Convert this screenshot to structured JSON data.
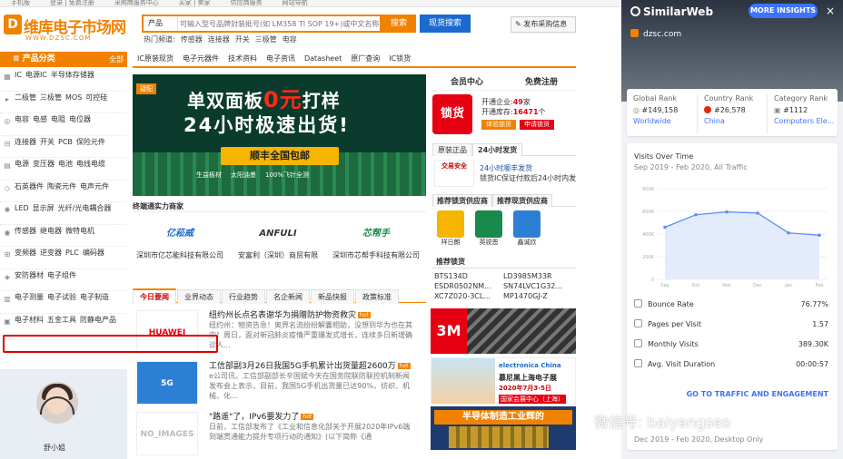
{
  "topstrip": [
    "手机版",
    "登录 | 免费注册",
    "采购商服务中心",
    "买家 | 卖家",
    "供应商服务",
    "网站导航"
  ],
  "logo": {
    "mark": "D",
    "name": "维库电子市场网",
    "url": "WWW.DZSC.COM"
  },
  "search": {
    "category": "产品",
    "placeholder": "可输入型号品牌封装批号(如 LM358 TI SOP 19+)或中文名称",
    "search_label": "搜索",
    "stock_label": "现货搜索",
    "post_label": "发布采购信息"
  },
  "hot": [
    "热门频道:",
    "传感器",
    "连接器",
    "开关",
    "三极管",
    "电容"
  ],
  "categories": {
    "title": "产品分类",
    "all": "全部",
    "items": [
      [
        "IC",
        "电源IC",
        "半导体存储器"
      ],
      [
        "二极管",
        "三极管",
        "MOS",
        "可控硅"
      ],
      [
        "电容",
        "电感",
        "电阻",
        "电位器"
      ],
      [
        "连接器",
        "开关",
        "PCB",
        "保险元件"
      ],
      [
        "电源",
        "变压器",
        "电池",
        "电线电缆"
      ],
      [
        "石英器件",
        "陶瓷元件",
        "电声元件"
      ],
      [
        "LED",
        "显示屏",
        "光纤/光电耦合器"
      ],
      [
        "传感器",
        "继电器",
        "微特电机"
      ],
      [
        "变频器",
        "逆变器",
        "PLC",
        "编码器"
      ],
      [
        "安防器材",
        "电子组件"
      ],
      [
        "电子测量",
        "电子试验",
        "电子制造"
      ],
      [
        "电子材料",
        "五金工具",
        "防静电产品"
      ]
    ]
  },
  "agent": {
    "name": "舒小姐"
  },
  "nav": [
    "IC原装现货",
    "电子元器件",
    "技术资料",
    "电子资讯",
    "Datasheet",
    "原厂查询",
    "IC锁货"
  ],
  "banner": {
    "tag": "捷配",
    "line1_a": "单双面板",
    "line1_b": "0元",
    "line1_c": "打样",
    "line2": "24小时极速出货!",
    "line3": "顺丰全国包邮",
    "features": [
      "生益板材",
      "太阳油墨",
      "100%飞针全测"
    ]
  },
  "brands_title": "终端通实力商家",
  "brands": [
    {
      "logo": "亿菘威",
      "name": "深圳市亿芯能科技有限公司"
    },
    {
      "logo": "ANFULI",
      "name": "安富利（深圳）商贸有限"
    },
    {
      "logo": "芯帮手",
      "name": "深圳市芯帮手科技有限公司"
    }
  ],
  "news_tabs": [
    "今日要闻",
    "业界动态",
    "行业趋势",
    "名企新闻",
    "新品快报",
    "政策标准"
  ],
  "news": [
    {
      "thumb": "HUAWEI",
      "title": "纽约州长点名表谢华为捐赠防护物资救灾",
      "desc": "纽约州：物资告急！奥界名流纷纷解囊相助，没想到华为也在其中！周日，面对新冠肺炎疫情严重爆发式增长，连续多日新增确诊人..."
    },
    {
      "thumb": "5G",
      "title": "工信部副3月26日我国5G手机累计出货量超2600万",
      "desc": "e公司讯，工信部副部长辛国斌今天在国务院联防联控机制新闻发布会上表示，目前，我国5G手机出货量已达90%，纺织、机械、化..."
    },
    {
      "thumb": "NO_IMAGES",
      "title": "\"路遥\"了，IPv6要发力了",
      "desc": "日前，工信部发布了《工业和信息化部关于开展2020年IPv6端到端贯通能力提升专项行动的通知》(以下简称《通"
    }
  ],
  "member": {
    "tab1": "会员中心",
    "tab2": "免费注册",
    "seal": "锁货",
    "stat1_label": "开通企业:",
    "stat1_value": "49",
    "stat1_unit": "家",
    "stat2_label": "开通库存:",
    "stat2_value": "16471",
    "stat2_unit": "个",
    "btn1": "体验锁货",
    "btn2": "申请锁货"
  },
  "ship_tabs": [
    "原装正品",
    "24小时发货"
  ],
  "ship": {
    "logo": "交易安全",
    "t1": "24小时顺丰发货",
    "t2": "锁货IC保证付款后24小时内发"
  },
  "sup_tabs": [
    "推荐锁货供应商",
    "推荐现货供应商"
  ],
  "suppliers": [
    "祥日朗",
    "英锐恩",
    "鑫诚欣"
  ],
  "stock_title": "推荐锁货",
  "parts": [
    "BTS134D",
    "LD3985M33R",
    "ESDR0502NM...",
    "SN74LVC1G32...",
    "XC7Z020-3CL...",
    "MP1470GJ-Z"
  ],
  "ad3m": "3M",
  "expo": {
    "brand": "electronica China",
    "t1": "慕尼黑上海电子展",
    "t2": "2020年7月3-5日",
    "t3": "国家会展中心（上海）"
  },
  "semi": "半导体制造工业辉的",
  "sw": {
    "brand": "SimilarWeb",
    "more": "MORE INSIGHTS",
    "close": "×",
    "site": "dzsc.com",
    "ranks": [
      {
        "h": "Global Rank",
        "v": "#149,158",
        "s": "Worldwide"
      },
      {
        "h": "Country Rank",
        "v": "#26,578",
        "s": "China"
      },
      {
        "h": "Category Rank",
        "v": "#1112",
        "s": "Computers Ele..."
      }
    ],
    "visits_title": "Visits Over Time",
    "visits_sub": "Sep 2019 - Feb 2020,  All Traffic",
    "metrics": [
      {
        "label": "Bounce Rate",
        "value": "76.77%"
      },
      {
        "label": "Pages per Visit",
        "value": "1.57"
      },
      {
        "label": "Monthly Visits",
        "value": "389.30K"
      },
      {
        "label": "Avg. Visit Duration",
        "value": "00:00:57"
      }
    ],
    "link": "GO TO TRAFFIC AND ENGAGEMENT",
    "footer": "Dec 2019 - Feb 2020,  Desktop Only"
  },
  "chart_data": {
    "type": "line",
    "categories": [
      "Sep",
      "Oct",
      "Nov",
      "Dec",
      "Jan",
      "Feb"
    ],
    "values": [
      460,
      570,
      595,
      585,
      410,
      390
    ],
    "yticks": [
      "0",
      "200K",
      "400K",
      "600K",
      "800K"
    ],
    "ylim": [
      0,
      800
    ]
  },
  "watermark": "微信号: baiyangseo",
  "colors": {
    "accent": "#f08200",
    "blue": "#1a6ad0",
    "sw_blue": "#3d73ff",
    "highlight": "#e00000"
  }
}
